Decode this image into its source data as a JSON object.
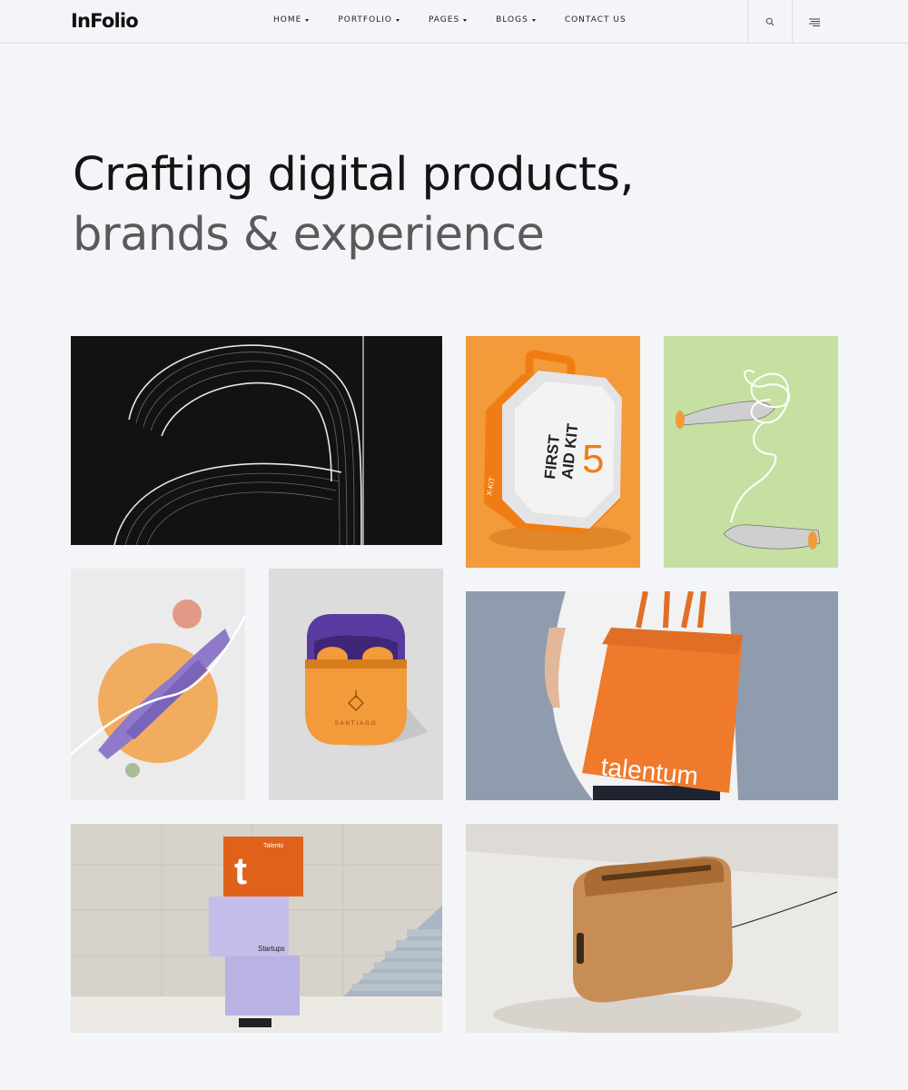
{
  "header": {
    "logo": "InFolio",
    "nav": [
      {
        "label": "HOME",
        "dropdown": true
      },
      {
        "label": "PORTFOLIO",
        "dropdown": true
      },
      {
        "label": "PAGES",
        "dropdown": true
      },
      {
        "label": "BLOGS",
        "dropdown": true
      },
      {
        "label": "CONTACT US",
        "dropdown": false
      }
    ],
    "search_icon": "search-icon",
    "menu_icon": "hamburger-menu-icon"
  },
  "hero": {
    "line1": "Crafting digital products,",
    "line2": "brands & experience"
  },
  "portfolio": {
    "kit": {
      "line1": "FIRST",
      "line2": "AID KIT",
      "number": "5",
      "side": "X-KIT"
    },
    "case": {
      "brand": "SANTIAGO"
    },
    "bag": {
      "brand": "talentum"
    },
    "boxes": {
      "top_letter": "t",
      "top_label": "Talents",
      "mid_label": "Startups"
    }
  },
  "colors": {
    "background": "#f4f5f8",
    "accent_orange": "#f39a3a",
    "text_dark": "#141414",
    "text_muted": "#5a5a5a"
  }
}
